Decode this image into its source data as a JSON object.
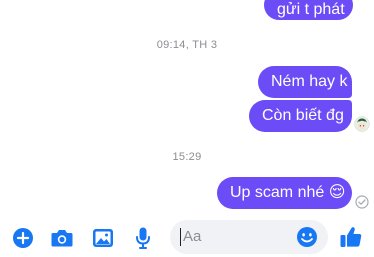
{
  "messages": [
    {
      "id": "m0",
      "text": "gửi t phát",
      "sender": "me"
    },
    {
      "id": "m1",
      "text": "Ném hay k",
      "sender": "me"
    },
    {
      "id": "m2",
      "text": "Còn biết đg",
      "sender": "me"
    },
    {
      "id": "m3",
      "text": "Up scam nhé 😌",
      "sender": "me"
    }
  ],
  "timestamps": [
    "09:14, TH 3",
    "15:29"
  ],
  "composer": {
    "placeholder": "Aa"
  },
  "icons": {
    "add": "plus-circle-icon",
    "camera": "camera-icon",
    "gallery": "image-icon",
    "mic": "microphone-icon",
    "emoji": "smile-icon",
    "like": "thumbs-up-icon",
    "seen": "avatar-seen-icon",
    "sent": "check-circle-icon"
  },
  "colors": {
    "bubble": "#6b4cf6",
    "accent": "#1877f2",
    "timestamp": "#8a8d91"
  }
}
